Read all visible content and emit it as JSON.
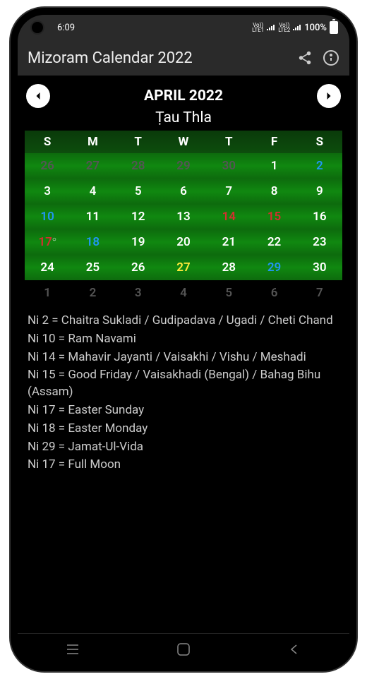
{
  "statusBar": {
    "time": "6:09",
    "sig1top": "Vo))",
    "sig1bot": "LTE1",
    "sig2top": "Vo))",
    "sig2bot": "LTE2",
    "battery": "100%"
  },
  "appBar": {
    "title": "Mizoram Calendar 2022"
  },
  "monthNav": {
    "title": "APRIL 2022",
    "subtitle": "Ṭau Thla"
  },
  "dayHeaders": [
    "S",
    "M",
    "T",
    "W",
    "T",
    "F",
    "S"
  ],
  "weeks": [
    [
      {
        "n": "26",
        "cls": "gray",
        "active": true
      },
      {
        "n": "27",
        "cls": "gray",
        "active": true
      },
      {
        "n": "28",
        "cls": "gray",
        "active": true
      },
      {
        "n": "29",
        "cls": "gray",
        "active": true
      },
      {
        "n": "30",
        "cls": "gray",
        "active": true
      },
      {
        "n": "1",
        "cls": "white",
        "active": true
      },
      {
        "n": "2",
        "cls": "blue",
        "active": true
      }
    ],
    [
      {
        "n": "3",
        "cls": "white",
        "active": true
      },
      {
        "n": "4",
        "cls": "white",
        "active": true
      },
      {
        "n": "5",
        "cls": "white",
        "active": true
      },
      {
        "n": "6",
        "cls": "white",
        "active": true
      },
      {
        "n": "7",
        "cls": "white",
        "active": true
      },
      {
        "n": "8",
        "cls": "white",
        "active": true
      },
      {
        "n": "9",
        "cls": "white",
        "active": true
      }
    ],
    [
      {
        "n": "10",
        "cls": "blue",
        "active": true
      },
      {
        "n": "11",
        "cls": "white",
        "active": true
      },
      {
        "n": "12",
        "cls": "white",
        "active": true
      },
      {
        "n": "13",
        "cls": "white",
        "active": true
      },
      {
        "n": "14",
        "cls": "red",
        "active": true
      },
      {
        "n": "15",
        "cls": "red",
        "active": true
      },
      {
        "n": "16",
        "cls": "white",
        "active": true
      }
    ],
    [
      {
        "n": "17",
        "cls": "red",
        "active": true,
        "moon": true
      },
      {
        "n": "18",
        "cls": "blue",
        "active": true
      },
      {
        "n": "19",
        "cls": "white",
        "active": true
      },
      {
        "n": "20",
        "cls": "white",
        "active": true
      },
      {
        "n": "21",
        "cls": "white",
        "active": true
      },
      {
        "n": "22",
        "cls": "white",
        "active": true
      },
      {
        "n": "23",
        "cls": "white",
        "active": true
      }
    ],
    [
      {
        "n": "24",
        "cls": "white",
        "active": true
      },
      {
        "n": "25",
        "cls": "white",
        "active": true
      },
      {
        "n": "26",
        "cls": "white",
        "active": true
      },
      {
        "n": "27",
        "cls": "yellow",
        "active": true
      },
      {
        "n": "28",
        "cls": "white",
        "active": true
      },
      {
        "n": "29",
        "cls": "blue",
        "active": true
      },
      {
        "n": "30",
        "cls": "white",
        "active": true
      }
    ],
    [
      {
        "n": "1",
        "cls": "gray",
        "active": false
      },
      {
        "n": "2",
        "cls": "gray",
        "active": false
      },
      {
        "n": "3",
        "cls": "gray",
        "active": false
      },
      {
        "n": "4",
        "cls": "gray",
        "active": false
      },
      {
        "n": "5",
        "cls": "gray",
        "active": false
      },
      {
        "n": "6",
        "cls": "gray",
        "active": false
      },
      {
        "n": "7",
        "cls": "gray",
        "active": false
      }
    ]
  ],
  "events": [
    "Ni 2 = Chaitra Sukladi / Gudipadava / Ugadi / Cheti Chand",
    "Ni 10 = Ram Navami",
    "Ni 14 = Mahavir Jayanti / Vaisakhi / Vishu / Meshadi",
    "Ni 15 = Good Friday / Vaisakhadi (Bengal) / Bahag Bihu (Assam)",
    "Ni 17 = Easter Sunday",
    "Ni 18 = Easter Monday",
    "Ni 29 = Jamat-Ul-Vida",
    "Ni 17 = Full Moon"
  ]
}
